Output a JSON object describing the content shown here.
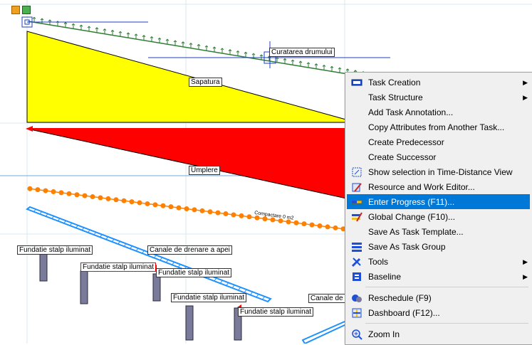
{
  "diagram": {
    "tasks": {
      "curatarea": "Curatarea drumului",
      "sapatura": "Sapatura",
      "umplere": "Umplere",
      "compactare": "Compactare 0 m2",
      "fundatie_1": "Fundatie stalp iluminat",
      "fundatie_2": "Fundatie stalp iluminat",
      "fundatie_3": "Fundatie stalp iluminat",
      "fundatie_4": "Fundatie stalp iluminat",
      "fundatie_5": "Fundatie stalp iluminat",
      "canale_1": "Canale de drenare a apei",
      "canale_2": "Canale de d"
    },
    "colors": {
      "sapatura": "#ffff00",
      "umplere": "#ff0000",
      "compactare": "#ff8000",
      "canale": "#1e90ff",
      "curatarea": "#2e7d32",
      "pillar": "#7a7a9a",
      "grid": "#d8e8f0",
      "guide": "#1f3fbf"
    }
  },
  "context_menu": {
    "items": [
      {
        "label": "Task Creation",
        "icon": "task-creation-icon",
        "submenu": true
      },
      {
        "label": "Task Structure",
        "icon": "",
        "submenu": true
      },
      {
        "label": "Add Task Annotation...",
        "icon": "",
        "submenu": false
      },
      {
        "label": "Copy Attributes from Another Task...",
        "icon": "",
        "submenu": false
      },
      {
        "label": "Create Predecessor",
        "icon": "",
        "submenu": false
      },
      {
        "label": "Create Successor",
        "icon": "",
        "submenu": false
      },
      {
        "label": "Show selection in Time-Distance View",
        "icon": "selection-icon",
        "submenu": false
      },
      {
        "label": "Resource and Work Editor...",
        "icon": "resource-editor-icon",
        "submenu": false
      },
      {
        "label": "Enter Progress (F11)...",
        "icon": "progress-icon",
        "submenu": false,
        "highlighted": true
      },
      {
        "label": "Global Change (F10)...",
        "icon": "global-change-icon",
        "submenu": false
      },
      {
        "label": "Save As Task Template...",
        "icon": "",
        "submenu": false
      },
      {
        "label": "Save As Task Group",
        "icon": "task-group-icon",
        "submenu": false
      },
      {
        "label": "Tools",
        "icon": "tools-icon",
        "submenu": true
      },
      {
        "label": "Baseline",
        "icon": "baseline-icon",
        "submenu": true
      },
      {
        "label": "Reschedule (F9)",
        "icon": "reschedule-icon",
        "submenu": false
      },
      {
        "label": "Dashboard (F12)...",
        "icon": "dashboard-icon",
        "submenu": false
      },
      {
        "label": "Zoom In",
        "icon": "zoom-in-icon",
        "submenu": false
      }
    ]
  }
}
